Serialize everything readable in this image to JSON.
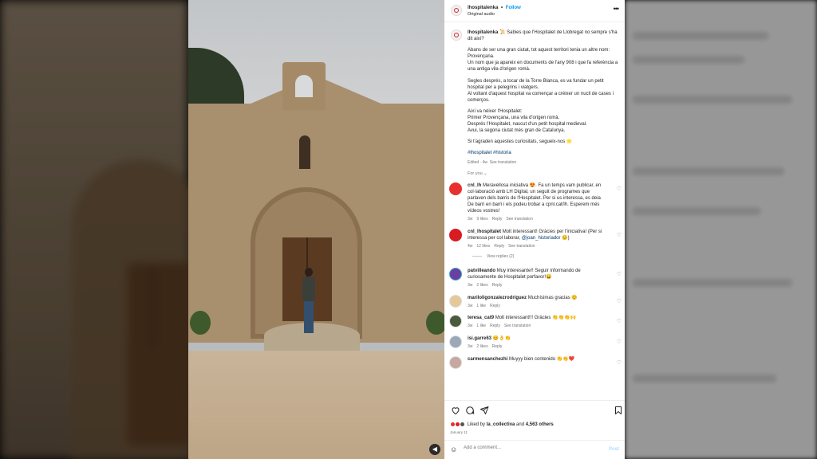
{
  "post": {
    "username": "lhospitalenka",
    "follow_label": "Follow",
    "separator": "•",
    "audio": "Original audio",
    "more_icon": "more-horizontal-icon"
  },
  "caption": {
    "username": "lhospitalenka",
    "line1": "📜 Sabies que l'Hospitalet de Llobregat no sempre s'ha dit així?",
    "p2": "Abans de ser una gran ciutat, tot aquest territori tenia un altre nom: Provençana.\nUn nom que ja apareix en documents de l'any 908 i que fa referència a una antiga vila d'origen romà.",
    "p3": "Segles després, a tocar de la Torre Blanca, es va fundar un petit hospital per a pelegrins i viatgers.\nAl voltant d'aquest hospital va començar a créixer un nucli de cases i comerços.",
    "p4": "Així va néixer l'Hospitalet:\nPrimer Provençana, una vila d'origen romà.\nDesprés l'Hospitalet, nascut d'un petit hospital medieval.\nAvui, la segona ciutat més gran de Catalunya.",
    "p5": "Si t'agraden aquestes curiositats, segueix-nos 🌟",
    "hashtags": "#lhospitalet #historia",
    "edited": "Edited · 4w",
    "see_translation": "See translation"
  },
  "for_you": "For you ⌄",
  "comments": [
    {
      "user": "cnl_lh",
      "text": "Meravellosa iniciativa 😍. Fa un temps vam publicar, en col·laboració amb LH Digital, un seguit de programes que parlaven dels barris de l'Hospitalet. Per si us interessa, es deia De barri en barri i els podeu trobar a cpnl.cat/lh. Esperem més vídeos vostres!",
      "age": "3w",
      "likes": "9 likes",
      "reply": "Reply",
      "extra": "See translation"
    },
    {
      "user": "cnl_lhospitalet",
      "text": "Molt interessant! Gràcies per l'iniciativa! (Per si interessa per col·laborar, ",
      "mention": "@joan_historiador",
      "after": " 😊)",
      "age": "4w",
      "likes": "12 likes",
      "reply": "Reply",
      "extra": "See translation"
    },
    {
      "user": "patvilleando",
      "text": "Muy interesante!! Seguir informando de curiosamente de Hospitalet porfavor!😄",
      "age": "3w",
      "likes": "2 likes",
      "reply": "Reply",
      "extra": ""
    },
    {
      "user": "mariloligonzalezrodriguez",
      "text": "Muchísimas gracias 😊",
      "age": "3w",
      "likes": "1 like",
      "reply": "Reply",
      "extra": ""
    },
    {
      "user": "teresa_cat9",
      "text": "Molt interessant!!! Gràcies 👏👏👏🙌",
      "age": "3w",
      "likes": "1 like",
      "reply": "Reply",
      "extra": "See translation"
    },
    {
      "user": "isi.garre63",
      "text": "😊👌👏",
      "age": "3w",
      "likes": "2 likes",
      "reply": "Reply",
      "extra": ""
    },
    {
      "user": "carmensanchezhi",
      "text": "Muyyy bien contenido 👏👏❤️",
      "age": "3w",
      "likes": "",
      "reply": "Reply",
      "extra": ""
    }
  ],
  "view_replies": "View replies (2)",
  "likes_line": {
    "prefix": "Liked by ",
    "user": "la_collectiva",
    "mid": " and ",
    "count": "4,563 others"
  },
  "date": "January 11",
  "add_comment": {
    "placeholder": "Add a comment...",
    "post_label": "Post"
  },
  "colors": {
    "accent": "#0095f6",
    "link": "#00376b",
    "muted": "#737373"
  }
}
